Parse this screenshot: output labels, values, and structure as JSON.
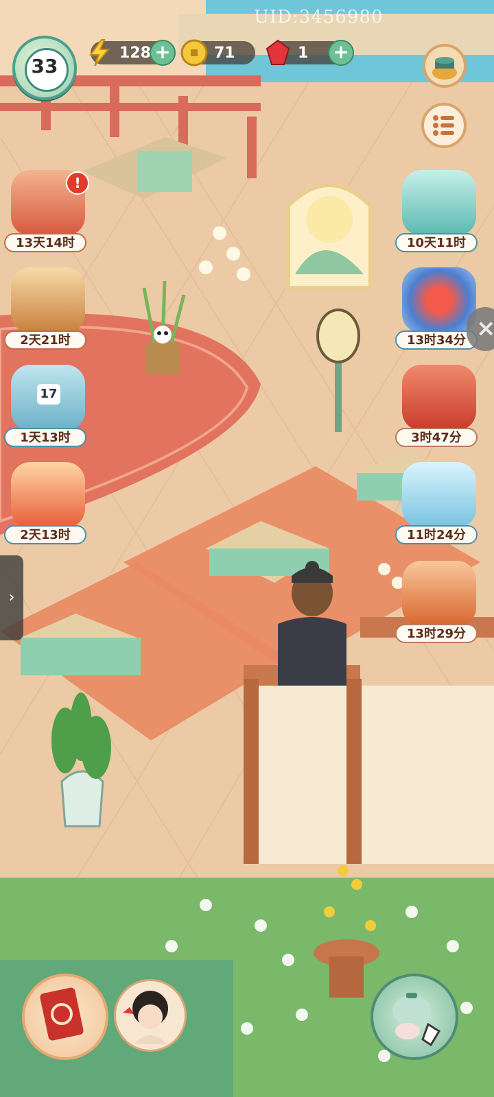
{
  "hud": {
    "uid": "UID:3456980",
    "level": "33",
    "energy": "128",
    "coins": "71",
    "gems": "1",
    "plus": "+"
  },
  "events_left": [
    {
      "timer": "13天14时",
      "icon": "autumn-book-event-icon",
      "alert": "!"
    },
    {
      "timer": "2天21时",
      "icon": "treasure-chest-icon"
    },
    {
      "timer": "1天13时",
      "icon": "lotus-calendar-icon",
      "badge": "17"
    },
    {
      "timer": "2天13时",
      "icon": "phoenix-dish-icon"
    }
  ],
  "events_right": [
    {
      "timer": "10天11时",
      "icon": "cat-pond-event-icon"
    },
    {
      "timer": "13时34分",
      "icon": "fan-event-icon"
    },
    {
      "timer": "3时47分",
      "icon": "red-lantern-box-icon"
    },
    {
      "timer": "11时24分",
      "icon": "cat-ice-cube-icon"
    },
    {
      "timer": "13时29分",
      "icon": "coin-bag-icon"
    }
  ],
  "side_tab": "›",
  "close": "×",
  "colors": {
    "teal": "#4aa08d",
    "coral": "#e26d5b",
    "cream": "#fffaf1"
  }
}
